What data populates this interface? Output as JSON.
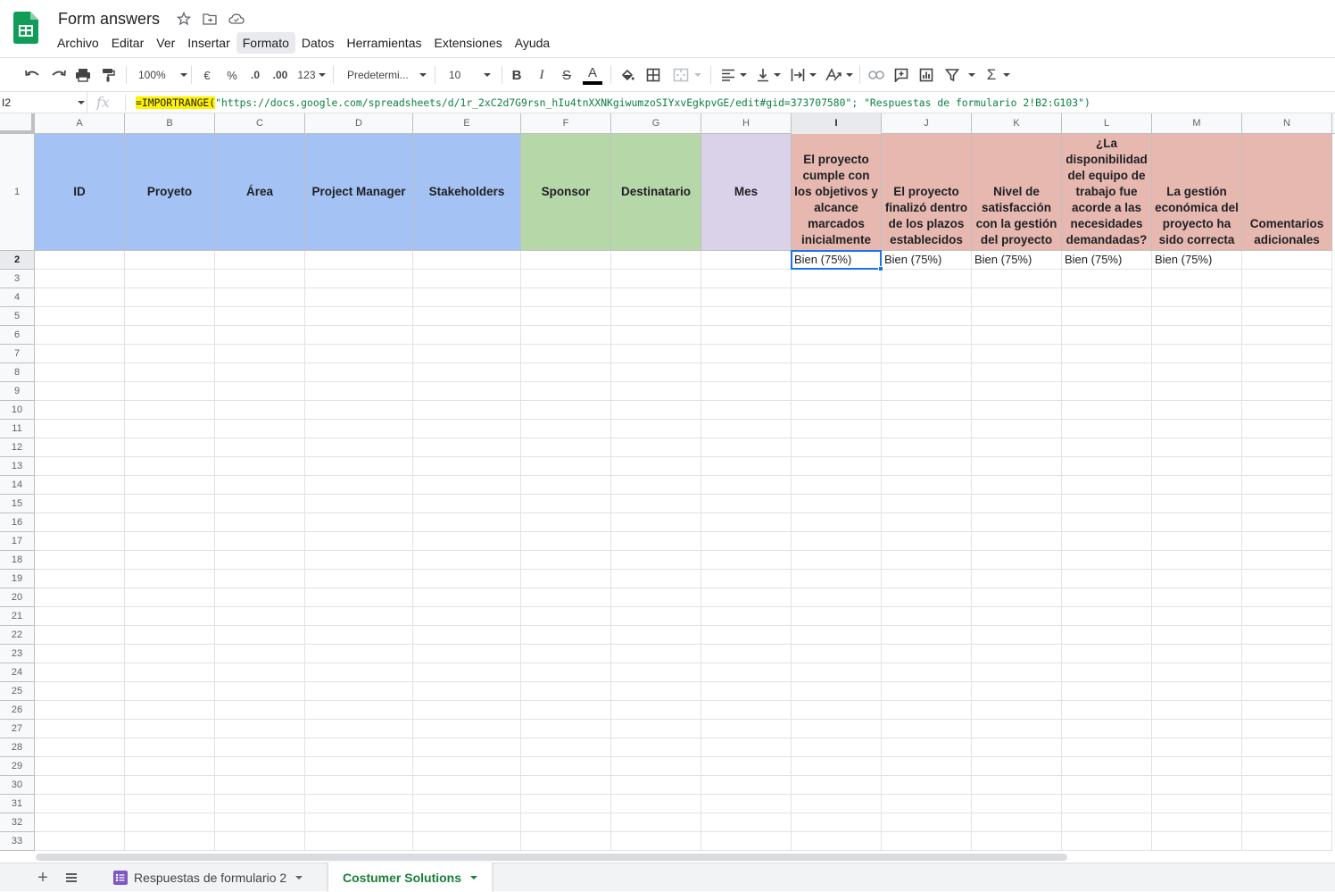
{
  "app": {
    "title": "Form answers",
    "menu": [
      "Archivo",
      "Editar",
      "Ver",
      "Insertar",
      "Formato",
      "Datos",
      "Herramientas",
      "Extensiones",
      "Ayuda"
    ],
    "active_menu": "Formato"
  },
  "toolbar": {
    "zoom": "100%",
    "currency": "€",
    "percent": "%",
    "decrease_decimals": ".0",
    "increase_decimals": ".00",
    "more_formats": "123",
    "font": "Predetermi...",
    "font_size": "10",
    "bold": "B",
    "italic": "I",
    "strike": "S",
    "text_color_glyph": "A",
    "functions": "Σ"
  },
  "formula_bar": {
    "cell_ref": "I2",
    "fx": "fx",
    "function_name": "=IMPORTRANGE(",
    "arguments": "\"https://docs.google.com/spreadsheets/d/1r_2xC2d7G9rsn_hIu4tnXXNKgiwumzoSIYxvEgkpvGE/edit#gid=373707580\"; \"Respuestas de formulario 2!B2:G103\")"
  },
  "grid": {
    "columns": [
      "A",
      "B",
      "C",
      "D",
      "E",
      "F",
      "G",
      "H",
      "I",
      "J",
      "K",
      "L",
      "M",
      "N"
    ],
    "selected_column": "I",
    "selected_row": "2",
    "rows": [
      "1",
      "2",
      "3",
      "4",
      "5",
      "6",
      "7",
      "8",
      "9",
      "10",
      "11",
      "12",
      "13",
      "14",
      "15",
      "16",
      "17",
      "18",
      "19",
      "20",
      "21",
      "22",
      "23",
      "24",
      "25",
      "26",
      "27",
      "28",
      "29",
      "30",
      "31",
      "32",
      "33"
    ],
    "header_row": [
      {
        "col": "A",
        "text": "ID",
        "color": "#a4c2f4"
      },
      {
        "col": "B",
        "text": "Proyeto",
        "color": "#a4c2f4"
      },
      {
        "col": "C",
        "text": "Área",
        "color": "#a4c2f4"
      },
      {
        "col": "D",
        "text": "Project Manager",
        "color": "#a4c2f4"
      },
      {
        "col": "E",
        "text": "Stakeholders",
        "color": "#a4c2f4"
      },
      {
        "col": "F",
        "text": "Sponsor",
        "color": "#b6d7a8"
      },
      {
        "col": "G",
        "text": "Destinatario",
        "color": "#b6d7a8"
      },
      {
        "col": "H",
        "text": "Mes",
        "color": "#d9d2e9"
      },
      {
        "col": "I",
        "text": "El proyecto cumple con los objetivos y alcance marcados inicialmente",
        "color": "#e6b8af"
      },
      {
        "col": "J",
        "text": "El proyecto finalizó dentro de los plazos establecidos",
        "color": "#e6b8af"
      },
      {
        "col": "K",
        "text": "Nivel de satisfacción con la gestión del proyecto",
        "color": "#e6b8af"
      },
      {
        "col": "L",
        "text": "¿La disponibilidad del equipo de trabajo fue acorde a las necesidades demandadas?",
        "color": "#e6b8af"
      },
      {
        "col": "M",
        "text": "La gestión económica del proyecto ha sido correcta",
        "color": "#e6b8af"
      },
      {
        "col": "N",
        "text": "Comentarios adicionales",
        "color": "#e6b8af"
      }
    ],
    "row2": {
      "I": "Bien (75%)",
      "J": "Bien (75%)",
      "K": "Bien (75%)",
      "L": "Bien (75%)",
      "M": "Bien (75%)"
    }
  },
  "sheets": {
    "tabs": [
      {
        "name": "Respuestas de formulario 2",
        "active": false
      },
      {
        "name": "Costumer Solutions",
        "active": true
      }
    ]
  }
}
